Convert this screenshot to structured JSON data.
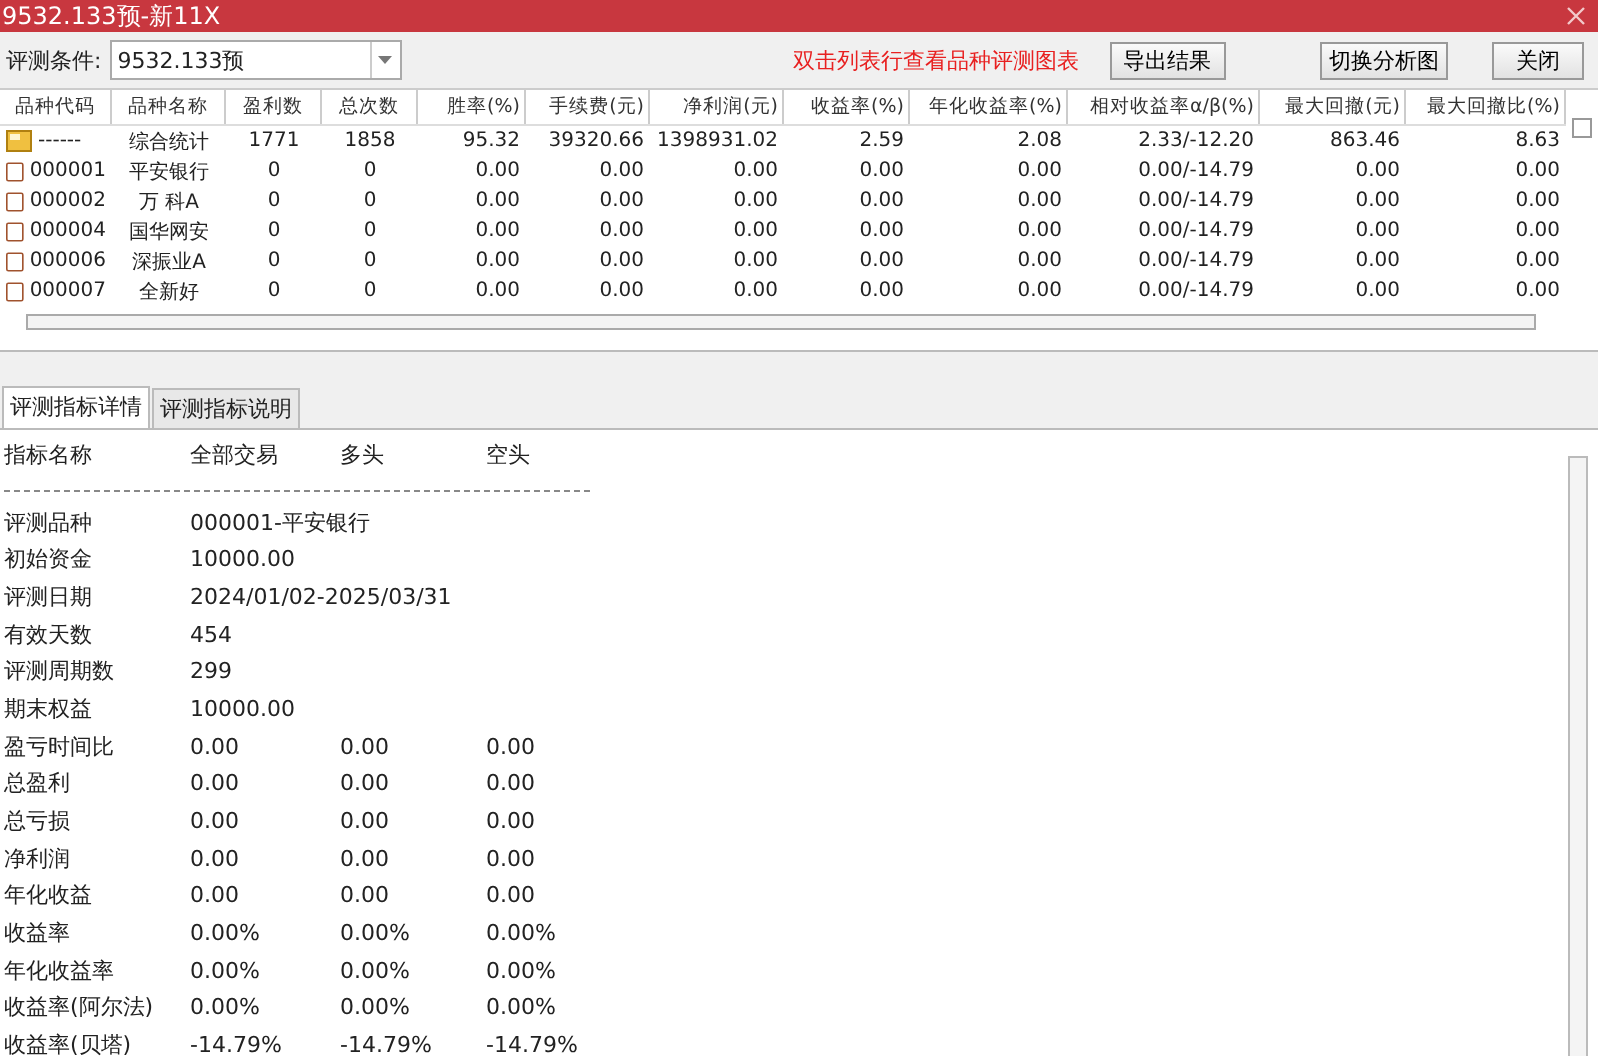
{
  "window": {
    "title": "9532.133预-新11X"
  },
  "toolbar": {
    "condition_label": "评测条件:",
    "condition_value": "9532.133预",
    "hint": "双击列表行查看品种评测图表",
    "buttons": [
      "导出结果",
      "切换分析图",
      "关闭"
    ]
  },
  "table": {
    "columns": [
      "品种代码",
      "品种名称",
      "盈利数",
      "总次数",
      "胜率(%)",
      "手续费(元)",
      "净利润(元)",
      "收益率(%)",
      "年化收益率(%)",
      "相对收益率α/β(%)",
      "最大回撤(元)",
      "最大回撤比(%)"
    ],
    "rows": [
      {
        "kind": "summary",
        "cells": [
          "------",
          "综合统计",
          "1771",
          "1858",
          "95.32",
          "39320.66",
          "1398931.02",
          "2.59",
          "2.08",
          "2.33/-12.20",
          "863.46",
          "8.63"
        ]
      },
      {
        "kind": "item",
        "cells": [
          "000001",
          "平安银行",
          "0",
          "0",
          "0.00",
          "0.00",
          "0.00",
          "0.00",
          "0.00",
          "0.00/-14.79",
          "0.00",
          "0.00"
        ]
      },
      {
        "kind": "item",
        "cells": [
          "000002",
          "万 科A",
          "0",
          "0",
          "0.00",
          "0.00",
          "0.00",
          "0.00",
          "0.00",
          "0.00/-14.79",
          "0.00",
          "0.00"
        ]
      },
      {
        "kind": "item",
        "cells": [
          "000004",
          "国华网安",
          "0",
          "0",
          "0.00",
          "0.00",
          "0.00",
          "0.00",
          "0.00",
          "0.00/-14.79",
          "0.00",
          "0.00"
        ]
      },
      {
        "kind": "item",
        "cells": [
          "000006",
          "深振业A",
          "0",
          "0",
          "0.00",
          "0.00",
          "0.00",
          "0.00",
          "0.00",
          "0.00/-14.79",
          "0.00",
          "0.00"
        ]
      },
      {
        "kind": "item",
        "cells": [
          "000007",
          "全新好",
          "0",
          "0",
          "0.00",
          "0.00",
          "0.00",
          "0.00",
          "0.00",
          "0.00/-14.79",
          "0.00",
          "0.00"
        ]
      }
    ],
    "checkbox": {
      "checked": false
    }
  },
  "tabs": [
    {
      "label": "评测指标详情",
      "selected": true
    },
    {
      "label": "评测指标说明",
      "selected": false
    }
  ],
  "details": {
    "header": [
      "指标名称",
      "全部交易",
      "多头",
      "空头"
    ],
    "rows": [
      {
        "label": "评测品种",
        "values": [
          "000001-平安银行"
        ]
      },
      {
        "label": "初始资金",
        "values": [
          "10000.00"
        ]
      },
      {
        "label": "评测日期",
        "values": [
          "2024/01/02-2025/03/31"
        ]
      },
      {
        "label": "有效天数",
        "values": [
          "454"
        ]
      },
      {
        "label": "评测周期数",
        "values": [
          "299"
        ]
      },
      {
        "label": "期末权益",
        "values": [
          "10000.00"
        ]
      },
      {
        "label": "盈亏时间比",
        "values": [
          "0.00",
          "0.00",
          "0.00"
        ]
      },
      {
        "label": "总盈利",
        "values": [
          "0.00",
          "0.00",
          "0.00"
        ]
      },
      {
        "label": "总亏损",
        "values": [
          "0.00",
          "0.00",
          "0.00"
        ]
      },
      {
        "label": "净利润",
        "values": [
          "0.00",
          "0.00",
          "0.00"
        ]
      },
      {
        "label": "年化收益",
        "values": [
          "0.00",
          "0.00",
          "0.00"
        ]
      },
      {
        "label": "收益率",
        "values": [
          "0.00%",
          "0.00%",
          "0.00%"
        ]
      },
      {
        "label": "年化收益率",
        "values": [
          "0.00%",
          "0.00%",
          "0.00%"
        ]
      },
      {
        "label": "收益率(阿尔法)",
        "values": [
          "0.00%",
          "0.00%",
          "0.00%"
        ]
      },
      {
        "label": "收益率(贝塔)",
        "values": [
          "-14.79%",
          "-14.79%",
          "-14.79%"
        ]
      }
    ]
  }
}
